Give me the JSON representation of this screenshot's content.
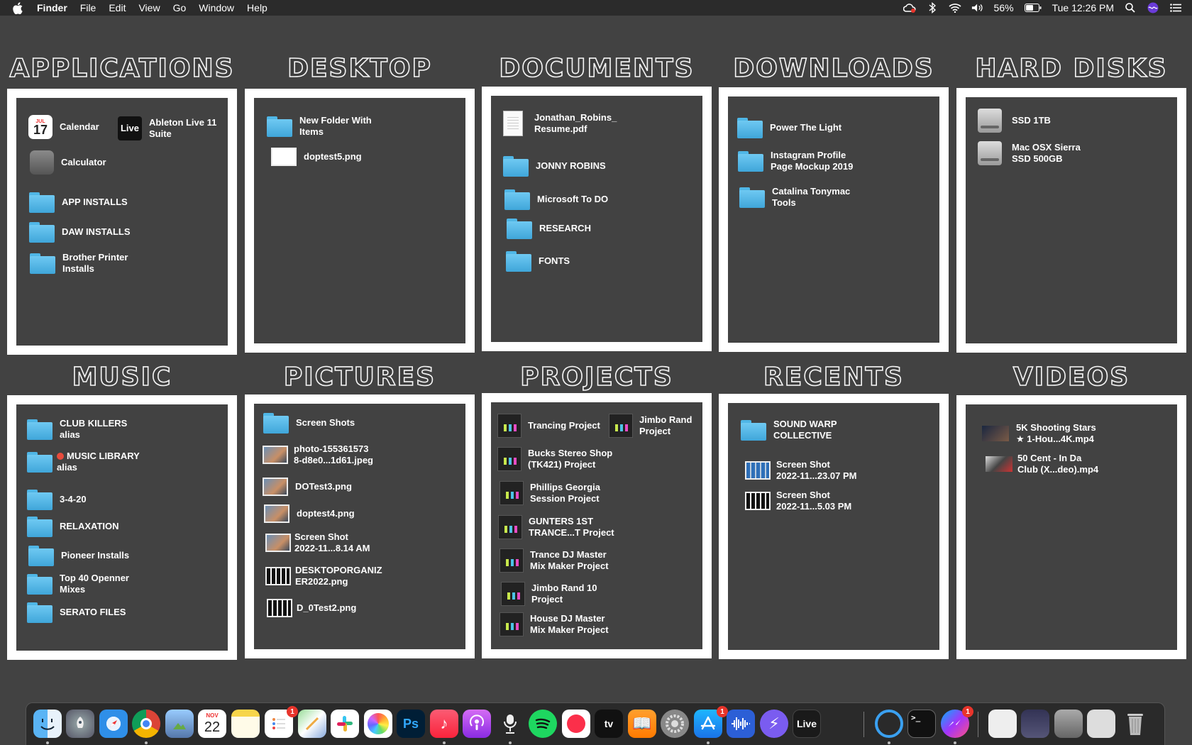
{
  "menubar": {
    "app_name": "Finder",
    "menus": [
      "File",
      "Edit",
      "View",
      "Go",
      "Window",
      "Help"
    ],
    "battery": "56%",
    "clock": "Tue 12:26 PM"
  },
  "sections": {
    "applications": {
      "title": "APPLICATIONS",
      "items": [
        {
          "label": "Calendar",
          "icon": "calendar-icon",
          "icon_text": "17",
          "icon_month": "JUL"
        },
        {
          "label": "Ableton Live 11\nSuite",
          "icon": "ableton-live-icon",
          "icon_text": "Live"
        },
        {
          "label": "Calculator",
          "icon": "calculator-icon"
        },
        {
          "label": "APP INSTALLS",
          "icon": "folder-icon"
        },
        {
          "label": "DAW INSTALLS",
          "icon": "folder-icon"
        },
        {
          "label": "Brother Printer\nInstalls",
          "icon": "folder-icon"
        }
      ]
    },
    "desktop": {
      "title": "DESKTOP",
      "items": [
        {
          "label": "New Folder With\nItems",
          "icon": "folder-icon"
        },
        {
          "label": "doptest5.png",
          "icon": "image-file-icon"
        }
      ]
    },
    "documents": {
      "title": "DOCUMENTS",
      "items": [
        {
          "label": "Jonathan_Robins_\nResume.pdf",
          "icon": "pdf-file-icon"
        },
        {
          "label": "JONNY ROBINS",
          "icon": "folder-icon"
        },
        {
          "label": "Microsoft To DO",
          "icon": "folder-icon"
        },
        {
          "label": "RESEARCH",
          "icon": "folder-icon"
        },
        {
          "label": "FONTS",
          "icon": "folder-icon"
        }
      ]
    },
    "downloads": {
      "title": "DOWNLOADS",
      "items": [
        {
          "label": "Power The Light",
          "icon": "folder-icon"
        },
        {
          "label": "Instagram Profile\nPage Mockup 2019",
          "icon": "folder-icon"
        },
        {
          "label": "Catalina Tonymac\nTools",
          "icon": "folder-icon"
        }
      ]
    },
    "hard_disks": {
      "title": "HARD DISKS",
      "items": [
        {
          "label": "SSD 1TB",
          "icon": "hard-disk-icon"
        },
        {
          "label": "Mac OSX Sierra\nSSD 500GB",
          "icon": "hard-disk-icon"
        }
      ]
    },
    "music": {
      "title": "MUSIC",
      "items": [
        {
          "label": "CLUB KILLERS\nalias",
          "icon": "folder-alias-icon"
        },
        {
          "label": "MUSIC LIBRARY\nalias",
          "icon": "folder-alias-icon",
          "tag": "red"
        },
        {
          "label": "3-4-20",
          "icon": "folder-icon"
        },
        {
          "label": "RELAXATION",
          "icon": "folder-icon"
        },
        {
          "label": "Pioneer Installs",
          "icon": "folder-icon"
        },
        {
          "label": "Top 40 Openner\nMixes",
          "icon": "folder-icon"
        },
        {
          "label": "SERATO FILES",
          "icon": "folder-icon"
        }
      ]
    },
    "pictures": {
      "title": "PICTURES",
      "items": [
        {
          "label": "Screen Shots",
          "icon": "folder-icon"
        },
        {
          "label": "photo-155361573\n8-d8e0...1d61.jpeg",
          "icon": "photo-file-icon"
        },
        {
          "label": "DOTest3.png",
          "icon": "image-file-icon"
        },
        {
          "label": "doptest4.png",
          "icon": "image-file-icon"
        },
        {
          "label": "Screen Shot\n2022-11...8.14 AM",
          "icon": "image-file-icon"
        },
        {
          "label": "DESKTOPORGANIZ\nER2022.png",
          "icon": "image-file-icon"
        },
        {
          "label": "D_0Test2.png",
          "icon": "image-file-icon"
        }
      ]
    },
    "projects": {
      "title": "PROJECTS",
      "items": [
        {
          "label": "Trancing Project",
          "icon": "ableton-project-icon"
        },
        {
          "label": "Jimbo Rand\nProject",
          "icon": "ableton-project-icon"
        },
        {
          "label": "Bucks Stereo Shop\n(TK421) Project",
          "icon": "ableton-project-icon"
        },
        {
          "label": "Phillips Georgia\nSession Project",
          "icon": "ableton-project-icon"
        },
        {
          "label": "GUNTERS 1ST\nTRANCE...T Project",
          "icon": "ableton-project-icon"
        },
        {
          "label": "Trance DJ Master\nMix Maker Project",
          "icon": "ableton-project-icon"
        },
        {
          "label": "Jimbo Rand 10\nProject",
          "icon": "ableton-project-icon"
        },
        {
          "label": "House DJ Master\nMix Maker Project",
          "icon": "ableton-project-icon"
        }
      ]
    },
    "recents": {
      "title": "RECENTS",
      "items": [
        {
          "label": "SOUND WARP\nCOLLECTIVE",
          "icon": "folder-icon"
        },
        {
          "label": "Screen Shot\n2022-11...23.07 PM",
          "icon": "image-file-icon"
        },
        {
          "label": "Screen Shot\n2022-11...5.03 PM",
          "icon": "image-file-icon"
        }
      ]
    },
    "videos": {
      "title": "VIDEOS",
      "items": [
        {
          "label": "5K Shooting Stars\n★ 1-Hou...4K.mp4",
          "icon": "video-file-icon"
        },
        {
          "label": "50 Cent - In Da\nClub (X...deo).mp4",
          "icon": "video-file-icon"
        }
      ]
    }
  },
  "dock": {
    "calendar_day": "22",
    "calendar_month": "NOV",
    "photoshop_label": "Ps",
    "live_label": "Live",
    "appletv_label": "tv",
    "badges": {
      "reminders": "1",
      "appstore": "1",
      "messenger": "1"
    }
  },
  "colors": {
    "background": "#424242",
    "frame": "#ffffff",
    "menubar": "#2b2b2b",
    "folder": "#4fb6e6"
  }
}
